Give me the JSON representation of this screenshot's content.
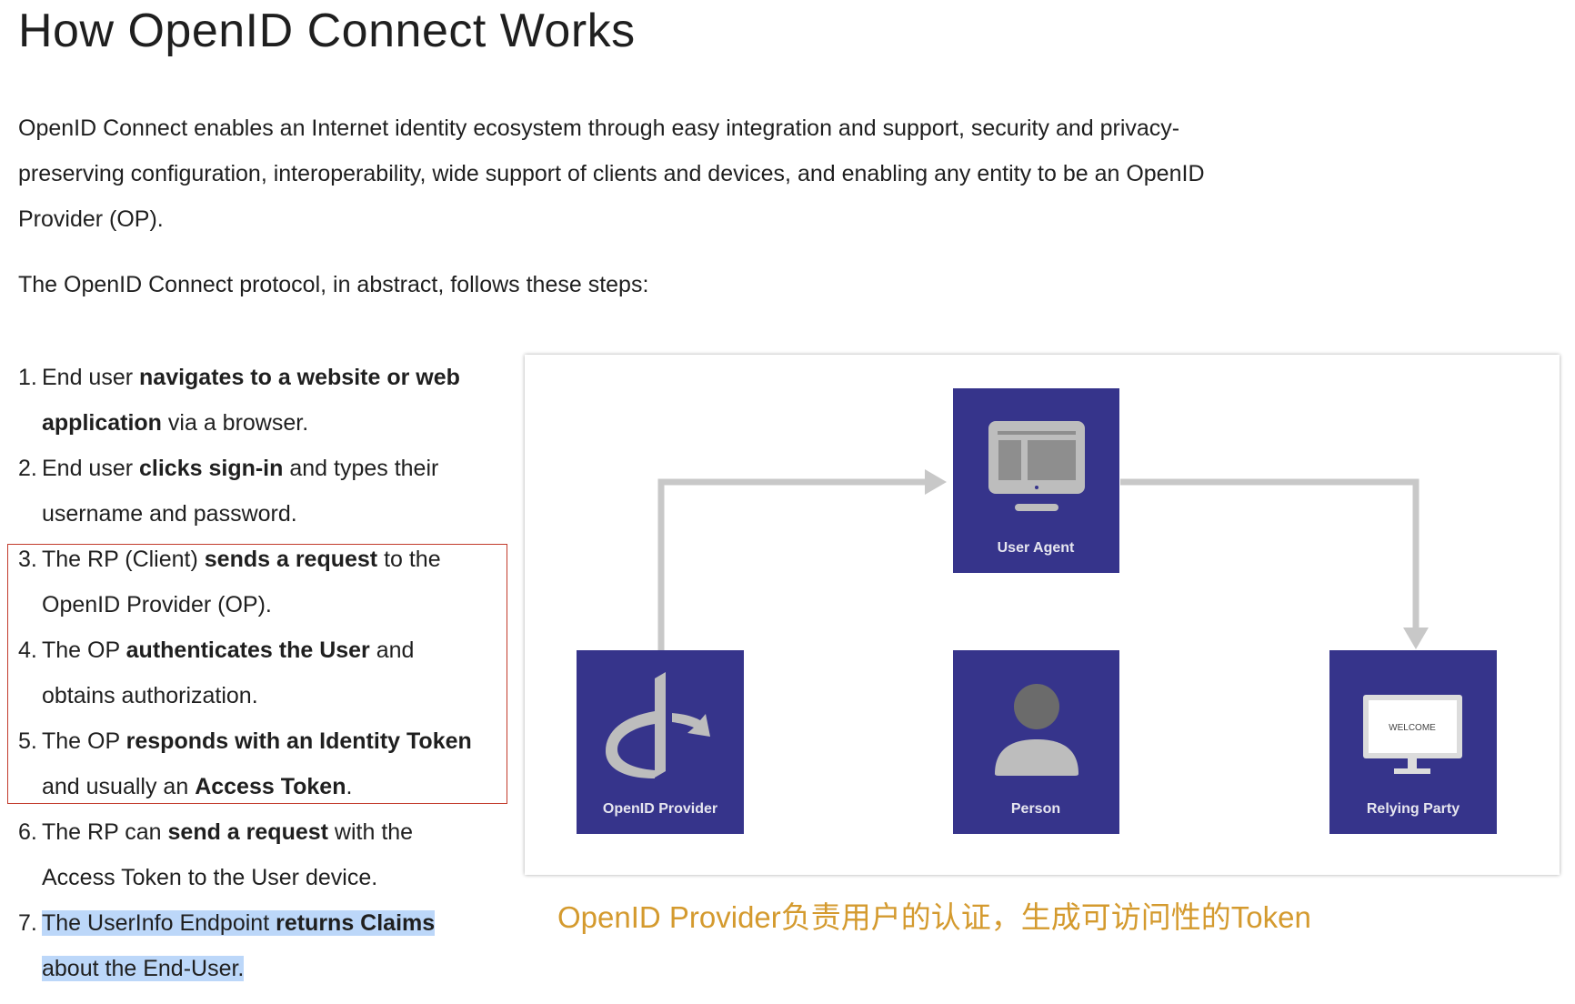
{
  "title": "How OpenID Connect Works",
  "intro": "OpenID Connect enables an Internet identity ecosystem through easy integration and support, security and privacy-preserving configuration, interoperability, wide support of clients and devices, and enabling any entity to be an OpenID Provider (OP).",
  "lead": "The OpenID Connect protocol, in abstract, follows these steps:",
  "steps": [
    {
      "num": "1.",
      "a": "End user ",
      "b": "navigates to a website or web application",
      "c": " via a browser.",
      "d": "",
      "e": ""
    },
    {
      "num": "2.",
      "a": "End user ",
      "b": "clicks sign-in",
      "c": " and types their username and password.",
      "d": "",
      "e": ""
    },
    {
      "num": "3.",
      "a": "The RP (Client) ",
      "b": "sends a request",
      "c": " to the OpenID Provider (OP).",
      "d": "",
      "e": ""
    },
    {
      "num": "4.",
      "a": "The OP ",
      "b": "authenticates the User",
      "c": " and obtains authorization.",
      "d": "",
      "e": ""
    },
    {
      "num": "5.",
      "a": "The OP ",
      "b": "responds with an Identity Token",
      "c": " and usually an ",
      "d": "Access Token",
      "e": "."
    },
    {
      "num": "6.",
      "a": "The RP can ",
      "b": "send a request",
      "c": " with the Access Token to the User device.",
      "d": "",
      "e": ""
    },
    {
      "num": "7.",
      "a": "The UserInfo Endpoint ",
      "b": "returns Claims",
      "c": " about the End-User.",
      "d": "",
      "e": ""
    }
  ],
  "diagram": {
    "user_agent_label": "User Agent",
    "openid_provider_label": "OpenID Provider",
    "person_label": "Person",
    "relying_party_label": "Relying Party",
    "welcome_text": "WELCOME",
    "box_color": "#36348b",
    "arrow_color": "#c8c8c8",
    "icon_color": "#bdbdbd"
  },
  "caption": "OpenID Provider负责用户的认证，生成可访问性的Token",
  "colors": {
    "highlight": "#bcd7f9",
    "red_box": "#c23a2b",
    "caption": "#d49a2e"
  }
}
